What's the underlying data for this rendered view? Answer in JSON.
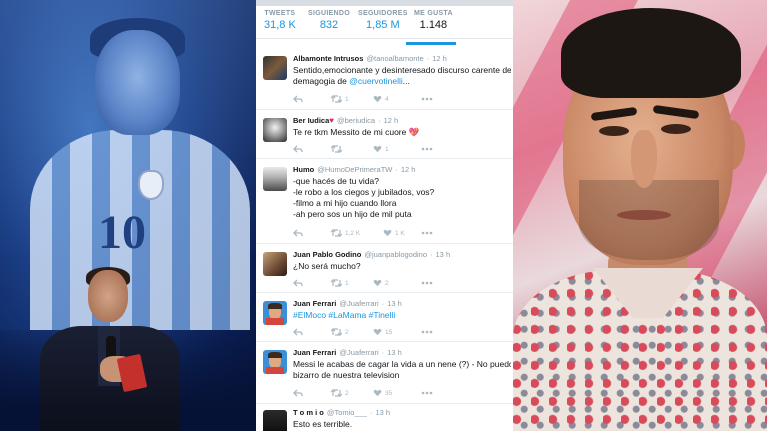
{
  "profile_stats": [
    {
      "label": "TWEETS",
      "value": "31,8 K"
    },
    {
      "label": "SIGUIENDO",
      "value": "832"
    },
    {
      "label": "SEGUIDORES",
      "value": "1,85 M"
    },
    {
      "label": "ME GUSTA",
      "value": "1.148"
    }
  ],
  "tweets": [
    {
      "name": "Albamonte Intrusos",
      "handle": "@tanoalbamonte",
      "time": "12 h",
      "line1": "Sentido,emocionante y desinteresado discurso carente de",
      "line2_prefix": "demagogia de ",
      "line2_link": "@cuervotinelli",
      "line2_suffix": "...",
      "retweets": "1",
      "likes": "4"
    },
    {
      "name": "Ber Iudica",
      "name_emoji": "♥",
      "handle": "@beriudica",
      "time": "12 h",
      "line1": "Te re tkm Messito de mi cuore 💖",
      "retweets": "",
      "likes": "1"
    },
    {
      "name": "Humo",
      "handle": "@HumoDePrimeraTW",
      "time": "12 h",
      "line1": "-que hacés de tu vida?",
      "line2": "-le robo a los ciegos y jubilados, vos?",
      "line3": "-filmo a mi hijo cuando llora",
      "line4": "-ah pero sos un hijo de mil puta",
      "retweets": "1,2 K",
      "likes": "1 K"
    },
    {
      "name": "Juan Pablo Godino",
      "handle": "@juanpablogodino",
      "time": "13 h",
      "line1": "¿No será mucho?",
      "retweets": "1",
      "likes": "2"
    },
    {
      "name": "Juan Ferrari",
      "handle": "@Juaferrari",
      "time": "13 h",
      "line1": "#ElMoco #LaMama #Tinelli",
      "retweets": "2",
      "likes": "15"
    },
    {
      "name": "Juan Ferrari",
      "handle": "@Juaferrari",
      "time": "13 h",
      "line1": "Messi le acabas de cagar la vida a un nene (?) - No puedo",
      "line2": "bizarro de nuestra television",
      "retweets": "2",
      "likes": "35"
    },
    {
      "name": "T o m i o",
      "handle": "@Tomio___",
      "time": "13 h",
      "line1": "Esto es terrible."
    }
  ],
  "left_photo": {
    "jersey_number": "10"
  },
  "colors": {
    "twitter_blue": "#1b95e0",
    "action_gray": "#aab8c2",
    "like_red": "#e0245e"
  }
}
